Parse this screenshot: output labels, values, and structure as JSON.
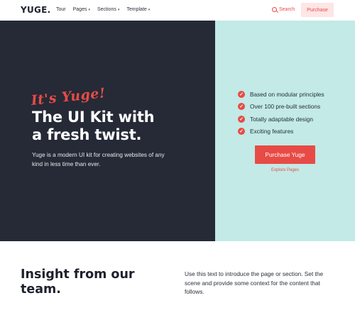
{
  "nav": {
    "logo": "YUGE.",
    "links": [
      {
        "label": "Tour",
        "has_dropdown": false
      },
      {
        "label": "Pages",
        "has_dropdown": true
      },
      {
        "label": "Sections",
        "has_dropdown": true
      },
      {
        "label": "Template",
        "has_dropdown": true
      }
    ],
    "search_label": "Search",
    "purchase_label": "Purchase"
  },
  "hero": {
    "script_text": "It's Yuge!",
    "headline_line1": "The UI Kit with",
    "headline_line2": "a fresh twist.",
    "subtext": "Yuge is a modern UI kit for creating websites of any kind in less time than ever.",
    "features": [
      "Based on modular principles",
      "Over 100 pre-built sections",
      "Totally adaptable design",
      "Exciting features"
    ],
    "cta_label": "Purchase Yuge",
    "secondary_link": "Explore Pages"
  },
  "section": {
    "title_line1": "Insight from our",
    "title_line2": "team.",
    "intro": "Use this text to introduce the page or section. Set the scene and provide some context for the content that follows."
  },
  "colors": {
    "accent": "#e84b46",
    "dark": "#252a36",
    "mint": "#c3eae6",
    "accent_light": "#fde6e5"
  },
  "icons": {
    "search": "search-icon",
    "check": "check-circle-icon",
    "caret": "chevron-down-icon"
  }
}
